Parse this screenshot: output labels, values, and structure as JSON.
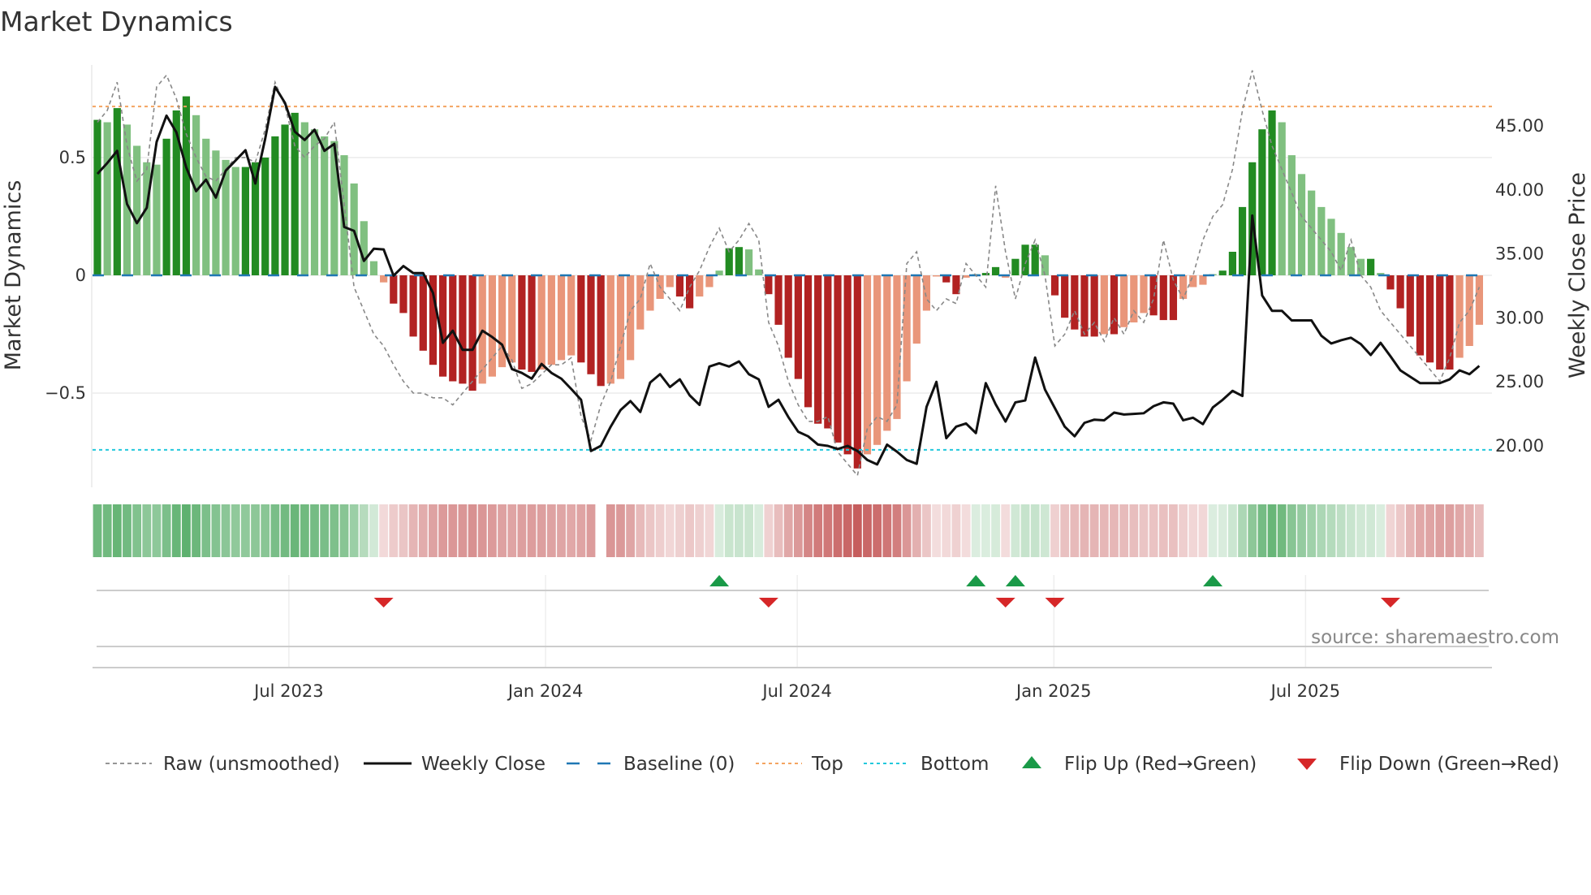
{
  "chart_data": {
    "type": "bar",
    "title": "Market Dynamics",
    "ylabel": "Market Dynamics",
    "y2label": "Weekly Close Price",
    "ylim": [
      -0.92,
      0.9
    ],
    "y2lim": [
      16.8,
      50.3
    ],
    "yticks": [
      {
        "v": 0.5,
        "label": "0.5"
      },
      {
        "v": 0,
        "label": "0"
      },
      {
        "v": -0.5,
        "label": "−0.5"
      }
    ],
    "y2ticks": [
      {
        "v": 45,
        "label": "45.00"
      },
      {
        "v": 40,
        "label": "40.00"
      },
      {
        "v": 35,
        "label": "35.00"
      },
      {
        "v": 30,
        "label": "30.00"
      },
      {
        "v": 25,
        "label": "25.00"
      },
      {
        "v": 20,
        "label": "20.00"
      }
    ],
    "xticks": [
      {
        "week": 19.4,
        "label": "Jul 2023"
      },
      {
        "week": 45.4,
        "label": "Jan 2024"
      },
      {
        "week": 70.9,
        "label": "Jul 2024"
      },
      {
        "week": 96.9,
        "label": "Jan 2025"
      },
      {
        "week": 122.4,
        "label": "Jul 2025"
      }
    ],
    "top_level": 0.717,
    "bottom_level": -0.741,
    "baseline": 0,
    "momentum": [
      0.66,
      0.65,
      0.71,
      0.64,
      0.55,
      0.48,
      0.47,
      0.58,
      0.7,
      0.76,
      0.68,
      0.58,
      0.53,
      0.49,
      0.46,
      0.46,
      0.48,
      0.5,
      0.59,
      0.64,
      0.69,
      0.65,
      0.62,
      0.59,
      0.57,
      0.51,
      0.39,
      0.23,
      0.06,
      -0.03,
      -0.12,
      -0.16,
      -0.26,
      -0.32,
      -0.38,
      -0.43,
      -0.45,
      -0.46,
      -0.49,
      -0.46,
      -0.43,
      -0.39,
      -0.37,
      -0.4,
      -0.41,
      -0.4,
      -0.38,
      -0.36,
      -0.34,
      -0.37,
      -0.42,
      -0.47,
      -0.46,
      -0.44,
      -0.36,
      -0.23,
      -0.15,
      -0.1,
      -0.05,
      -0.09,
      -0.14,
      -0.09,
      -0.05,
      0.02,
      0.115,
      0.12,
      0.11,
      0.025,
      -0.08,
      -0.21,
      -0.35,
      -0.44,
      -0.56,
      -0.63,
      -0.65,
      -0.71,
      -0.76,
      -0.82,
      -0.76,
      -0.72,
      -0.66,
      -0.61,
      -0.45,
      -0.29,
      -0.15,
      -0.005,
      -0.03,
      -0.08,
      -0.01,
      0.005,
      0.01,
      0.035,
      -0.01,
      0.07,
      0.13,
      0.13,
      0.085,
      -0.085,
      -0.18,
      -0.23,
      -0.26,
      -0.26,
      -0.25,
      -0.25,
      -0.22,
      -0.2,
      -0.16,
      -0.17,
      -0.19,
      -0.19,
      -0.1,
      -0.05,
      -0.04,
      0.005,
      0.02,
      0.1,
      0.29,
      0.48,
      0.62,
      0.7,
      0.65,
      0.51,
      0.43,
      0.36,
      0.29,
      0.24,
      0.18,
      0.12,
      0.07,
      0.07,
      0.01,
      -0.06,
      -0.14,
      -0.26,
      -0.34,
      -0.37,
      -0.4,
      -0.4,
      -0.35,
      -0.3,
      -0.21
    ],
    "raw": [
      0.65,
      0.7,
      0.82,
      0.55,
      0.4,
      0.45,
      0.8,
      0.85,
      0.75,
      0.6,
      0.5,
      0.42,
      0.4,
      0.45,
      0.5,
      0.5,
      0.48,
      0.62,
      0.82,
      0.72,
      0.55,
      0.5,
      0.55,
      0.58,
      0.65,
      0.3,
      -0.05,
      -0.15,
      -0.25,
      -0.3,
      -0.38,
      -0.45,
      -0.5,
      -0.5,
      -0.52,
      -0.52,
      -0.55,
      -0.5,
      -0.45,
      -0.4,
      -0.35,
      -0.3,
      -0.36,
      -0.48,
      -0.46,
      -0.42,
      -0.38,
      -0.38,
      -0.35,
      -0.6,
      -0.7,
      -0.55,
      -0.45,
      -0.3,
      -0.15,
      -0.1,
      0.05,
      -0.05,
      -0.1,
      -0.15,
      -0.05,
      0.02,
      0.12,
      0.2,
      0.1,
      0.15,
      0.22,
      0.15,
      -0.2,
      -0.3,
      -0.45,
      -0.55,
      -0.62,
      -0.62,
      -0.6,
      -0.75,
      -0.8,
      -0.85,
      -0.65,
      -0.6,
      -0.62,
      -0.55,
      0.05,
      0.1,
      -0.1,
      -0.15,
      -0.1,
      -0.12,
      0.05,
      0.0,
      -0.05,
      0.38,
      0.1,
      -0.1,
      0.05,
      0.15,
      0.0,
      -0.3,
      -0.25,
      -0.15,
      -0.25,
      -0.2,
      -0.28,
      -0.18,
      -0.25,
      -0.15,
      -0.2,
      -0.1,
      0.15,
      -0.02,
      -0.1,
      0.0,
      0.15,
      0.25,
      0.3,
      0.45,
      0.7,
      0.87,
      0.7,
      0.55,
      0.45,
      0.35,
      0.25,
      0.2,
      0.15,
      0.1,
      0.02,
      0.15,
      0.0,
      -0.05,
      -0.15,
      -0.2,
      -0.25,
      -0.3,
      -0.35,
      -0.4,
      -0.45,
      -0.35,
      -0.2,
      -0.15,
      -0.05
    ],
    "close": [
      41.25,
      42.1,
      43.05,
      38.9,
      37.4,
      38.6,
      43.75,
      45.8,
      44.5,
      41.75,
      39.9,
      40.8,
      39.4,
      41.5,
      42.3,
      43.1,
      40.5,
      44,
      48.05,
      46.8,
      44.55,
      43.9,
      44.7,
      43.05,
      43.6,
      37.1,
      36.8,
      34.45,
      35.4,
      35.35,
      33.3,
      34.05,
      33.5,
      33.5,
      31.95,
      28.05,
      29,
      27.5,
      27.5,
      29,
      28.5,
      27.9,
      26,
      25.7,
      25.25,
      26.4,
      25.7,
      25.25,
      24.45,
      23.6,
      19.6,
      20,
      21.5,
      22.8,
      23.5,
      22.65,
      24.95,
      25.6,
      24.6,
      25.2,
      23.95,
      23.2,
      26.2,
      26.45,
      26.2,
      26.6,
      25.6,
      25.2,
      23.05,
      23.6,
      22.25,
      21.1,
      20.75,
      20.1,
      20,
      19.75,
      20,
      19.6,
      18.9,
      18.55,
      20.1,
      19.55,
      18.9,
      18.6,
      23.05,
      25,
      20.6,
      21.5,
      21.75,
      21,
      24.9,
      23.25,
      21.9,
      23.4,
      23.55,
      26.9,
      24.4,
      22.95,
      21.5,
      20.75,
      21.8,
      22.05,
      22,
      22.6,
      22.45,
      22.5,
      22.55,
      23.1,
      23.4,
      23.3,
      22,
      22.2,
      21.7,
      23,
      23.6,
      24.3,
      23.9,
      38,
      31.75,
      30.55,
      30.55,
      29.8,
      29.8,
      29.8,
      28.6,
      28,
      28.25,
      28.45,
      27.95,
      27.1,
      28.05,
      27,
      25.9,
      25.4,
      24.9,
      24.9,
      24.9,
      25.2,
      25.9,
      25.6,
      26.25
    ],
    "heat_missing_weeks": [
      51
    ],
    "flip_up_weeks": [
      63,
      89,
      93,
      113
    ],
    "flip_down_weeks": [
      29,
      68,
      92,
      97,
      131
    ],
    "legend": {
      "placement": "bottom",
      "raw": "Raw (unsmoothed)",
      "close": "Weekly Close",
      "baseline": "Baseline (0)",
      "top": "Top",
      "bottom": "Bottom",
      "flip_up": "Flip Up (Red→Green)",
      "flip_down": "Flip Down (Green→Red)"
    },
    "source": "source: sharemaestro.com",
    "colors": {
      "strong_green": "#228b22",
      "weak_green": "#80c080",
      "strong_red": "#b22222",
      "weak_red": "#e9967a",
      "baseline": "#1f77b4",
      "top": "#f4a460",
      "bottom": "#22c8dc",
      "flip_up": "#1a9a48",
      "flip_down": "#d62728"
    }
  }
}
